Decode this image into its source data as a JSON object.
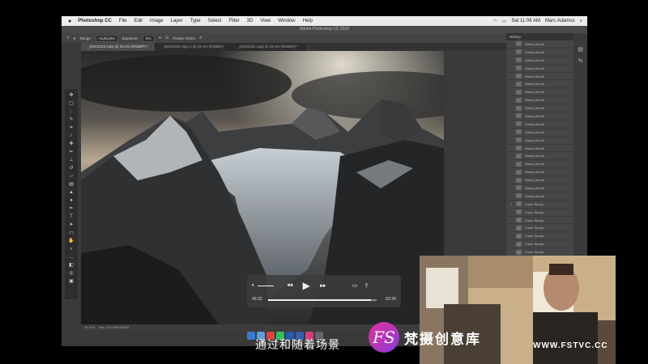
{
  "menubar": {
    "app_name": "Photoshop CC",
    "menus": [
      "File",
      "Edit",
      "Image",
      "Layer",
      "Type",
      "Select",
      "Filter",
      "3D",
      "View",
      "Window",
      "Help"
    ],
    "clock": "Sat 11:06 AM",
    "user": "Marc Adamus"
  },
  "window_title": "Adobe Photoshop CC 2018",
  "options": {
    "range_label": "Range:",
    "range_value": "Highlights",
    "exposure_label": "Exposure:",
    "exposure_value": "8%",
    "protect_tones": "Protect Tones"
  },
  "tabs": [
    {
      "label": "_DSC0123 copy @ 29.1% (RGB/8*) *",
      "active": true
    },
    {
      "label": "_DSC0123 copy 2 @ 29.1% (RGB/8*)",
      "active": false
    },
    {
      "label": "_DSC0123 copy @ 29.1% (RGB/8*) *",
      "active": false
    }
  ],
  "status": {
    "zoom": "29.11%",
    "doc": "Doc: 133.4M/133.8M"
  },
  "history": {
    "title": "History",
    "items": [
      {
        "label": "History Brush",
        "icon": "brush"
      },
      {
        "label": "History Brush",
        "icon": "brush"
      },
      {
        "label": "History Brush",
        "icon": "brush"
      },
      {
        "label": "History Brush",
        "icon": "brush"
      },
      {
        "label": "History Brush",
        "icon": "brush"
      },
      {
        "label": "History Brush",
        "icon": "brush"
      },
      {
        "label": "History Brush",
        "icon": "brush"
      },
      {
        "label": "History Brush",
        "icon": "brush"
      },
      {
        "label": "History Brush",
        "icon": "brush"
      },
      {
        "label": "History Brush",
        "icon": "brush"
      },
      {
        "label": "History Brush",
        "icon": "brush"
      },
      {
        "label": "History Brush",
        "icon": "brush"
      },
      {
        "label": "History Brush",
        "icon": "brush"
      },
      {
        "label": "History Brush",
        "icon": "brush"
      },
      {
        "label": "History Brush",
        "icon": "brush"
      },
      {
        "label": "History Brush",
        "icon": "brush"
      },
      {
        "label": "History Brush",
        "icon": "brush"
      },
      {
        "label": "History Brush",
        "icon": "brush"
      },
      {
        "label": "History Brush",
        "icon": "brush"
      },
      {
        "label": "History Brush",
        "icon": "brush"
      },
      {
        "label": "Clone Stamp",
        "icon": "stamp"
      },
      {
        "label": "Clone Stamp",
        "icon": "stamp"
      },
      {
        "label": "Clone Stamp",
        "icon": "stamp"
      },
      {
        "label": "Clone Stamp",
        "icon": "stamp"
      },
      {
        "label": "Clone Stamp",
        "icon": "stamp"
      },
      {
        "label": "Clone Stamp",
        "icon": "stamp"
      },
      {
        "label": "Clone Stamp",
        "icon": "stamp"
      },
      {
        "label": "Clone Stamp",
        "icon": "stamp"
      },
      {
        "label": "Clone Stamp",
        "icon": "stamp"
      },
      {
        "label": "Clone Stamp",
        "icon": "stamp"
      }
    ]
  },
  "video": {
    "elapsed": "46:33",
    "remaining": "-02:39",
    "progress": 0.95
  },
  "subtitle": "通过和随着场景",
  "watermark": {
    "logo": "FS",
    "brand": "梵摄创意库",
    "site": "WWW.FSTVC.CC"
  }
}
